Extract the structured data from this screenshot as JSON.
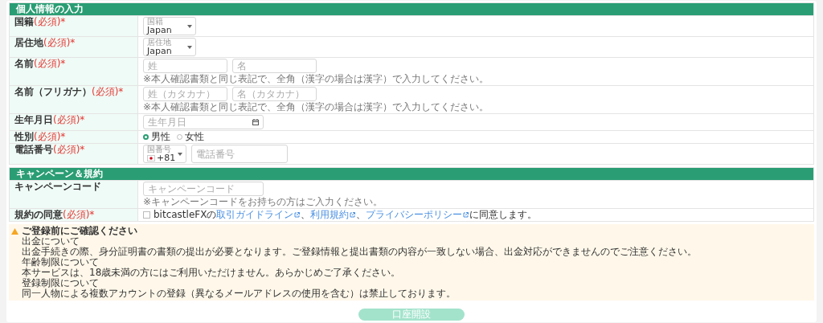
{
  "sections": [
    {
      "title": "個人情報の入力",
      "rows": [
        {
          "label": "国籍",
          "required_mark": "(必須)*",
          "kind": "select",
          "field_label": "国籍",
          "value": "Japan"
        },
        {
          "label": "居住地",
          "required_mark": "(必須)*",
          "kind": "select",
          "field_label": "居住地",
          "value": "Japan"
        },
        {
          "label": "名前",
          "required_mark": "(必須)*",
          "kind": "pair",
          "placeholders": [
            "姓",
            "名"
          ],
          "hint": "※本人確認書類と同じ表記で、全角（漢字の場合は漢字）で入力してください。"
        },
        {
          "label": "名前（フリガナ）",
          "required_mark": "(必須)*",
          "kind": "pair",
          "placeholders": [
            "姓（カタカナ）",
            "名（カタカナ）"
          ],
          "hint": "※本人確認書類と同じ表記で、全角（漢字の場合は漢字）で入力してください。"
        },
        {
          "label": "生年月日",
          "required_mark": "(必須)*",
          "kind": "date",
          "placeholder": "生年月日"
        },
        {
          "label": "性別",
          "required_mark": "(必須)*",
          "kind": "radio",
          "options": [
            {
              "label": "男性",
              "selected": true
            },
            {
              "label": "女性",
              "selected": false
            }
          ]
        },
        {
          "label": "電話番号",
          "required_mark": "(必須)*",
          "kind": "phone",
          "field_label": "国番号",
          "value": "+81",
          "placeholder": "電話番号"
        }
      ]
    },
    {
      "title": "キャンペーン＆規約",
      "rows": [
        {
          "label": "キャンペーンコード",
          "kind": "text",
          "placeholder": "キャンペーンコード",
          "hint": "※キャンペーンコードをお持ちの方はご入力ください。"
        },
        {
          "label": "規約の同意",
          "required_mark": "(必須)*",
          "kind": "agreement",
          "checked": false,
          "prefix": "bitcastleFXの",
          "links": [
            {
              "text": "取引ガイドライン",
              "after": "、"
            },
            {
              "text": "利用規約",
              "after": "、"
            },
            {
              "text": "プライバシーポリシー"
            }
          ],
          "suffix": "に同意します。"
        }
      ]
    }
  ],
  "notice": {
    "title": "ご登録前にご確認ください",
    "items": [
      {
        "heading": "出金について",
        "body": "出金手続きの際、身分証明書の書類の提出が必要となります。ご登録情報と提出書類の内容が一致しない場合、出金対応ができませんのでご注意ください。"
      },
      {
        "heading": "年齢制限について",
        "body": "本サービスは、18歳未満の方にはご利用いただけません。あらかじめご了承ください。"
      },
      {
        "heading": "登録制限について",
        "body": "同一人物による複数アカウントの登録（異なるメールアドレスの使用を含む）は禁止しております。"
      }
    ]
  },
  "submit": {
    "label": "口座開設",
    "disabled": true
  }
}
